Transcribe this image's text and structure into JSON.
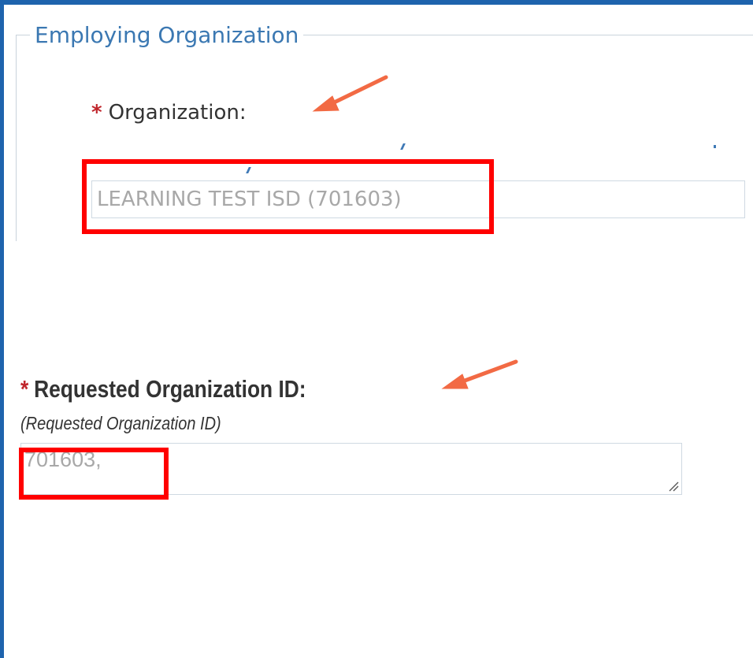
{
  "employing_organization": {
    "legend": "Employing Organization",
    "organization": {
      "required_marker": "*",
      "label": "Organization:",
      "value": "LEARNING TEST ISD (701603)"
    }
  },
  "requested_organization_id": {
    "required_marker": "*",
    "label": "Requested Organization ID:",
    "help_text": "(Requested Organization ID)",
    "value": "701603,"
  },
  "annotations": {
    "arrow_color": "#f26a44",
    "highlight_color": "#ff0000"
  },
  "colors": {
    "frame_border": "#1e63ad",
    "legend_text": "#3b78b2",
    "required": "#c0262c",
    "input_text": "#a8a8a8"
  }
}
